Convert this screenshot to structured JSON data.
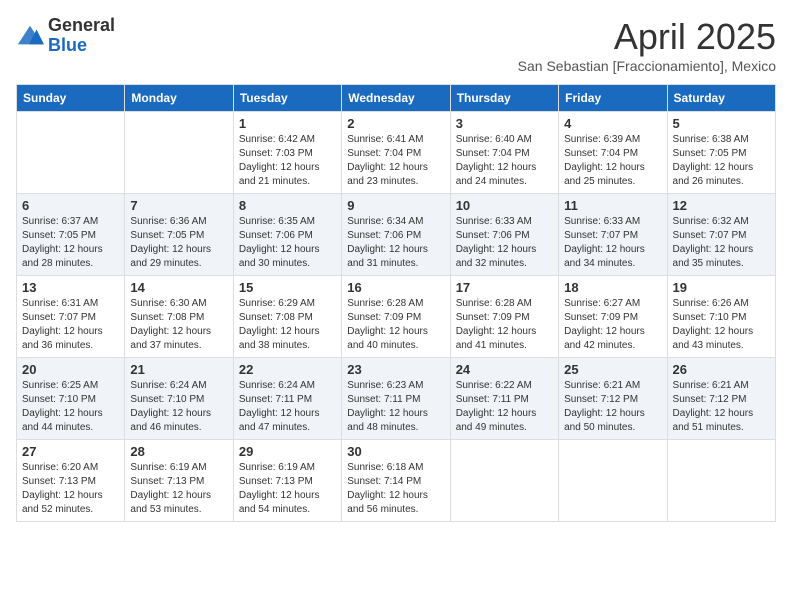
{
  "logo": {
    "general": "General",
    "blue": "Blue"
  },
  "title": "April 2025",
  "subtitle": "San Sebastian [Fraccionamiento], Mexico",
  "days_of_week": [
    "Sunday",
    "Monday",
    "Tuesday",
    "Wednesday",
    "Thursday",
    "Friday",
    "Saturday"
  ],
  "weeks": [
    [
      {
        "day": "",
        "sunrise": "",
        "sunset": "",
        "daylight": ""
      },
      {
        "day": "",
        "sunrise": "",
        "sunset": "",
        "daylight": ""
      },
      {
        "day": "1",
        "sunrise": "Sunrise: 6:42 AM",
        "sunset": "Sunset: 7:03 PM",
        "daylight": "Daylight: 12 hours and 21 minutes."
      },
      {
        "day": "2",
        "sunrise": "Sunrise: 6:41 AM",
        "sunset": "Sunset: 7:04 PM",
        "daylight": "Daylight: 12 hours and 23 minutes."
      },
      {
        "day": "3",
        "sunrise": "Sunrise: 6:40 AM",
        "sunset": "Sunset: 7:04 PM",
        "daylight": "Daylight: 12 hours and 24 minutes."
      },
      {
        "day": "4",
        "sunrise": "Sunrise: 6:39 AM",
        "sunset": "Sunset: 7:04 PM",
        "daylight": "Daylight: 12 hours and 25 minutes."
      },
      {
        "day": "5",
        "sunrise": "Sunrise: 6:38 AM",
        "sunset": "Sunset: 7:05 PM",
        "daylight": "Daylight: 12 hours and 26 minutes."
      }
    ],
    [
      {
        "day": "6",
        "sunrise": "Sunrise: 6:37 AM",
        "sunset": "Sunset: 7:05 PM",
        "daylight": "Daylight: 12 hours and 28 minutes."
      },
      {
        "day": "7",
        "sunrise": "Sunrise: 6:36 AM",
        "sunset": "Sunset: 7:05 PM",
        "daylight": "Daylight: 12 hours and 29 minutes."
      },
      {
        "day": "8",
        "sunrise": "Sunrise: 6:35 AM",
        "sunset": "Sunset: 7:06 PM",
        "daylight": "Daylight: 12 hours and 30 minutes."
      },
      {
        "day": "9",
        "sunrise": "Sunrise: 6:34 AM",
        "sunset": "Sunset: 7:06 PM",
        "daylight": "Daylight: 12 hours and 31 minutes."
      },
      {
        "day": "10",
        "sunrise": "Sunrise: 6:33 AM",
        "sunset": "Sunset: 7:06 PM",
        "daylight": "Daylight: 12 hours and 32 minutes."
      },
      {
        "day": "11",
        "sunrise": "Sunrise: 6:33 AM",
        "sunset": "Sunset: 7:07 PM",
        "daylight": "Daylight: 12 hours and 34 minutes."
      },
      {
        "day": "12",
        "sunrise": "Sunrise: 6:32 AM",
        "sunset": "Sunset: 7:07 PM",
        "daylight": "Daylight: 12 hours and 35 minutes."
      }
    ],
    [
      {
        "day": "13",
        "sunrise": "Sunrise: 6:31 AM",
        "sunset": "Sunset: 7:07 PM",
        "daylight": "Daylight: 12 hours and 36 minutes."
      },
      {
        "day": "14",
        "sunrise": "Sunrise: 6:30 AM",
        "sunset": "Sunset: 7:08 PM",
        "daylight": "Daylight: 12 hours and 37 minutes."
      },
      {
        "day": "15",
        "sunrise": "Sunrise: 6:29 AM",
        "sunset": "Sunset: 7:08 PM",
        "daylight": "Daylight: 12 hours and 38 minutes."
      },
      {
        "day": "16",
        "sunrise": "Sunrise: 6:28 AM",
        "sunset": "Sunset: 7:09 PM",
        "daylight": "Daylight: 12 hours and 40 minutes."
      },
      {
        "day": "17",
        "sunrise": "Sunrise: 6:28 AM",
        "sunset": "Sunset: 7:09 PM",
        "daylight": "Daylight: 12 hours and 41 minutes."
      },
      {
        "day": "18",
        "sunrise": "Sunrise: 6:27 AM",
        "sunset": "Sunset: 7:09 PM",
        "daylight": "Daylight: 12 hours and 42 minutes."
      },
      {
        "day": "19",
        "sunrise": "Sunrise: 6:26 AM",
        "sunset": "Sunset: 7:10 PM",
        "daylight": "Daylight: 12 hours and 43 minutes."
      }
    ],
    [
      {
        "day": "20",
        "sunrise": "Sunrise: 6:25 AM",
        "sunset": "Sunset: 7:10 PM",
        "daylight": "Daylight: 12 hours and 44 minutes."
      },
      {
        "day": "21",
        "sunrise": "Sunrise: 6:24 AM",
        "sunset": "Sunset: 7:10 PM",
        "daylight": "Daylight: 12 hours and 46 minutes."
      },
      {
        "day": "22",
        "sunrise": "Sunrise: 6:24 AM",
        "sunset": "Sunset: 7:11 PM",
        "daylight": "Daylight: 12 hours and 47 minutes."
      },
      {
        "day": "23",
        "sunrise": "Sunrise: 6:23 AM",
        "sunset": "Sunset: 7:11 PM",
        "daylight": "Daylight: 12 hours and 48 minutes."
      },
      {
        "day": "24",
        "sunrise": "Sunrise: 6:22 AM",
        "sunset": "Sunset: 7:11 PM",
        "daylight": "Daylight: 12 hours and 49 minutes."
      },
      {
        "day": "25",
        "sunrise": "Sunrise: 6:21 AM",
        "sunset": "Sunset: 7:12 PM",
        "daylight": "Daylight: 12 hours and 50 minutes."
      },
      {
        "day": "26",
        "sunrise": "Sunrise: 6:21 AM",
        "sunset": "Sunset: 7:12 PM",
        "daylight": "Daylight: 12 hours and 51 minutes."
      }
    ],
    [
      {
        "day": "27",
        "sunrise": "Sunrise: 6:20 AM",
        "sunset": "Sunset: 7:13 PM",
        "daylight": "Daylight: 12 hours and 52 minutes."
      },
      {
        "day": "28",
        "sunrise": "Sunrise: 6:19 AM",
        "sunset": "Sunset: 7:13 PM",
        "daylight": "Daylight: 12 hours and 53 minutes."
      },
      {
        "day": "29",
        "sunrise": "Sunrise: 6:19 AM",
        "sunset": "Sunset: 7:13 PM",
        "daylight": "Daylight: 12 hours and 54 minutes."
      },
      {
        "day": "30",
        "sunrise": "Sunrise: 6:18 AM",
        "sunset": "Sunset: 7:14 PM",
        "daylight": "Daylight: 12 hours and 56 minutes."
      },
      {
        "day": "",
        "sunrise": "",
        "sunset": "",
        "daylight": ""
      },
      {
        "day": "",
        "sunrise": "",
        "sunset": "",
        "daylight": ""
      },
      {
        "day": "",
        "sunrise": "",
        "sunset": "",
        "daylight": ""
      }
    ]
  ]
}
